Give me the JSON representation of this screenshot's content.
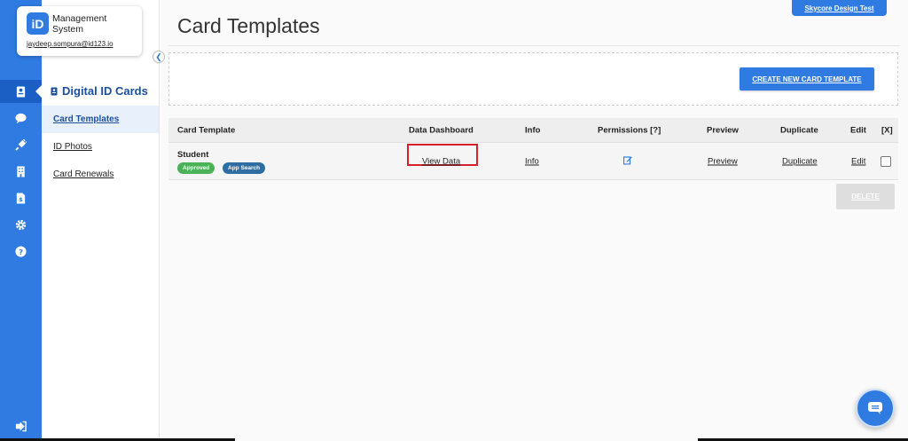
{
  "brand": {
    "logo": "iD",
    "name": "Management System",
    "user_email": "jaydeep.sompura@id123.io"
  },
  "rail": {
    "icons": [
      "id-card-icon",
      "chat-icon",
      "plug-icon",
      "building-icon",
      "document-dollar-icon",
      "gear-icon",
      "help-icon",
      "logout-icon"
    ]
  },
  "secnav": {
    "title": "Digital ID Cards",
    "items": [
      {
        "label": "Card Templates"
      },
      {
        "label": "ID Photos"
      },
      {
        "label": "Card Renewals"
      }
    ]
  },
  "header": {
    "title": "Card Templates",
    "org_button": "Skycore Design Test"
  },
  "actions": {
    "create_label": "CREATE NEW CARD TEMPLATE",
    "delete_label": "DELETE"
  },
  "table": {
    "columns": [
      "Card Template",
      "Data Dashboard",
      "Info",
      "Permissions [?]",
      "Preview",
      "Duplicate",
      "Edit",
      "[X]"
    ],
    "rows": [
      {
        "name": "Student",
        "badges": [
          "Approved",
          "App Search"
        ],
        "dashboard": "View Data",
        "info": "Info",
        "preview": "Preview",
        "duplicate": "Duplicate",
        "edit": "Edit"
      }
    ]
  },
  "colors": {
    "primary": "#2f7be2",
    "title": "#1c4fa0",
    "approved": "#4bb25a",
    "app_search": "#2f6ea3",
    "highlight": "#d6202c"
  }
}
